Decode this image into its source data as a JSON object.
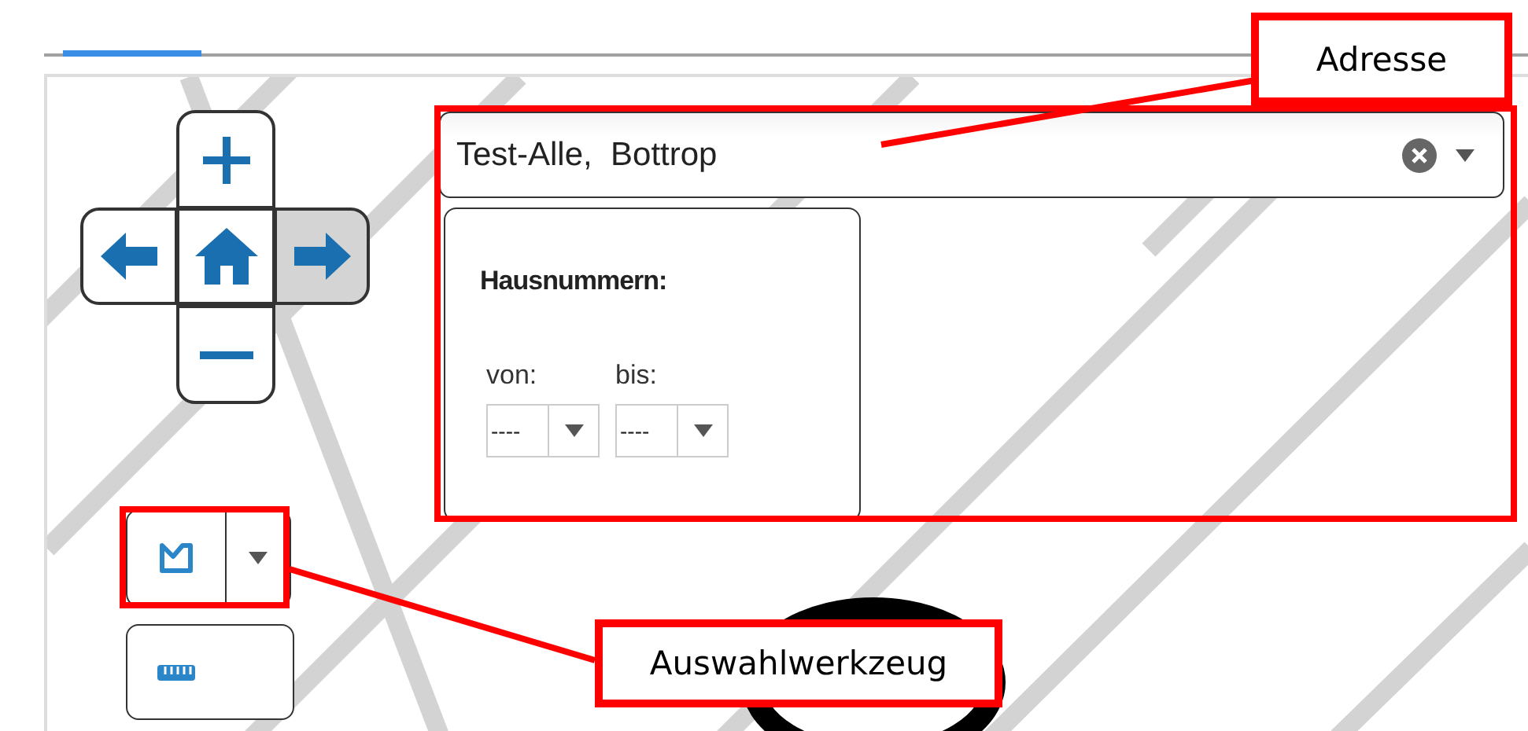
{
  "nav_buttons": [
    {
      "kind": "zoom_in",
      "hovered": false
    },
    {
      "kind": "pan_left",
      "hovered": false
    },
    {
      "kind": "home",
      "hovered": false
    },
    {
      "kind": "pan_right",
      "hovered": true
    },
    {
      "kind": "zoom_out",
      "hovered": false
    }
  ],
  "address": {
    "value": "Test-Alle,  Bottrop"
  },
  "house_numbers": {
    "title": "Hausnummern:",
    "from": {
      "label": "von:",
      "value": "----"
    },
    "to": {
      "label": "bis:",
      "value": "----"
    }
  },
  "tools": [
    {
      "kind": "selection",
      "has_menu": true
    },
    {
      "kind": "measure",
      "has_menu": false
    }
  ],
  "annotations": [
    {
      "kind": "address",
      "text": "Adresse"
    },
    {
      "kind": "tool",
      "text": "Auswahlwerkzeug"
    }
  ]
}
